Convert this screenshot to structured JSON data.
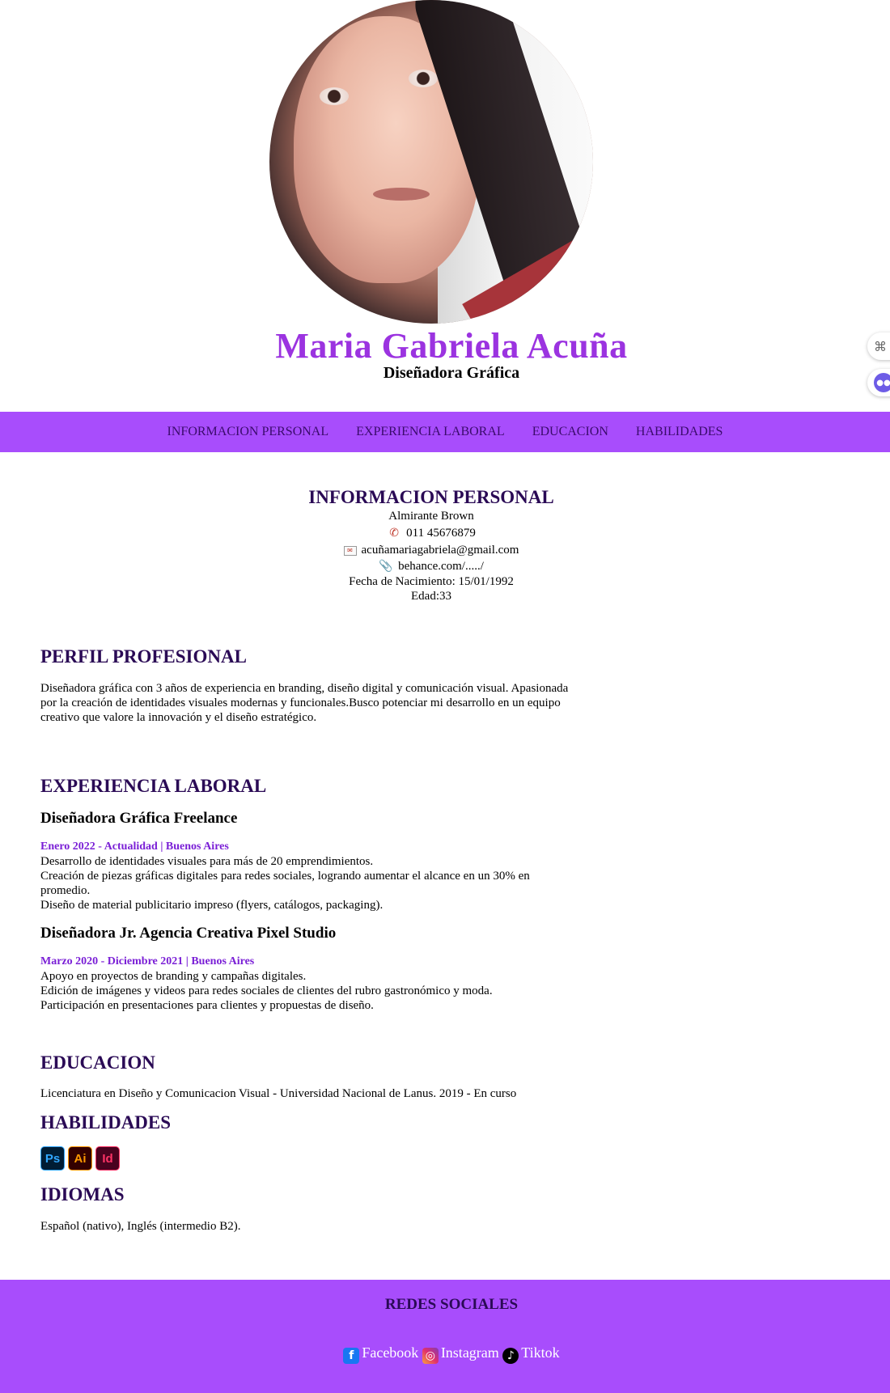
{
  "header": {
    "name": "Maria Gabriela Acuña",
    "role": "Diseñadora Gráfica"
  },
  "nav": {
    "items": [
      "INFORMACION PERSONAL",
      "EXPERIENCIA LABORAL",
      "EDUCACION",
      "HABILIDADES"
    ]
  },
  "personal": {
    "title": "INFORMACION PERSONAL",
    "location": "Almirante Brown",
    "phone": "011 45676879",
    "email": "acuñamariagabriela@gmail.com",
    "portfolio": "behance.com/...../",
    "birth": "Fecha de Nacimiento: 15/01/1992",
    "age": "Edad:33"
  },
  "profile": {
    "title": "PERFIL PROFESIONAL",
    "lines": [
      "Diseñadora gráfica con 3 años de experiencia en branding, diseño digital y comunicación visual. Apasionada",
      "por la creación de identidades visuales modernas y funcionales.Busco potenciar mi desarrollo en un equipo",
      "creativo que valore la innovación y el diseño estratégico."
    ]
  },
  "experience": {
    "title": "EXPERIENCIA LABORAL",
    "jobs": [
      {
        "title": "Diseñadora Gráfica Freelance",
        "dates": "Enero 2022 - Actualidad | Buenos Aires",
        "lines": [
          "Desarrollo de identidades visuales para más de 20 emprendimientos.",
          "Creación de piezas gráficas digitales para redes sociales, logrando aumentar el alcance en un 30% en",
          "promedio.",
          "Diseño de material publicitario impreso (flyers, catálogos, packaging)."
        ]
      },
      {
        "title": "Diseñadora Jr. Agencia Creativa Pixel Studio",
        "dates": "Marzo 2020 - Diciembre 2021 | Buenos Aires",
        "lines": [
          "Apoyo en proyectos de branding y campañas digitales.",
          "Edición de imágenes y videos para redes sociales de clientes del rubro gastronómico y moda.",
          "Participación en presentaciones para clientes y propuestas de diseño."
        ]
      }
    ]
  },
  "education": {
    "title": "EDUCACION",
    "text": "Licenciatura en Diseño y Comunicacion Visual - Universidad Nacional de Lanus. 2019 - En curso"
  },
  "skills": {
    "title": "HABILIDADES",
    "items": [
      "Ps",
      "Ai",
      "Id"
    ]
  },
  "languages": {
    "title": "IDIOMAS",
    "text": "Español (nativo), Inglés (intermedio B2)."
  },
  "footer": {
    "title": "REDES SOCIALES",
    "links": [
      "Facebook",
      "Instagram",
      "Tiktok"
    ]
  },
  "colors": {
    "accent": "#a84dfc",
    "name": "#9b33e0",
    "heading": "#2a0a55",
    "date": "#7a1fd6"
  }
}
